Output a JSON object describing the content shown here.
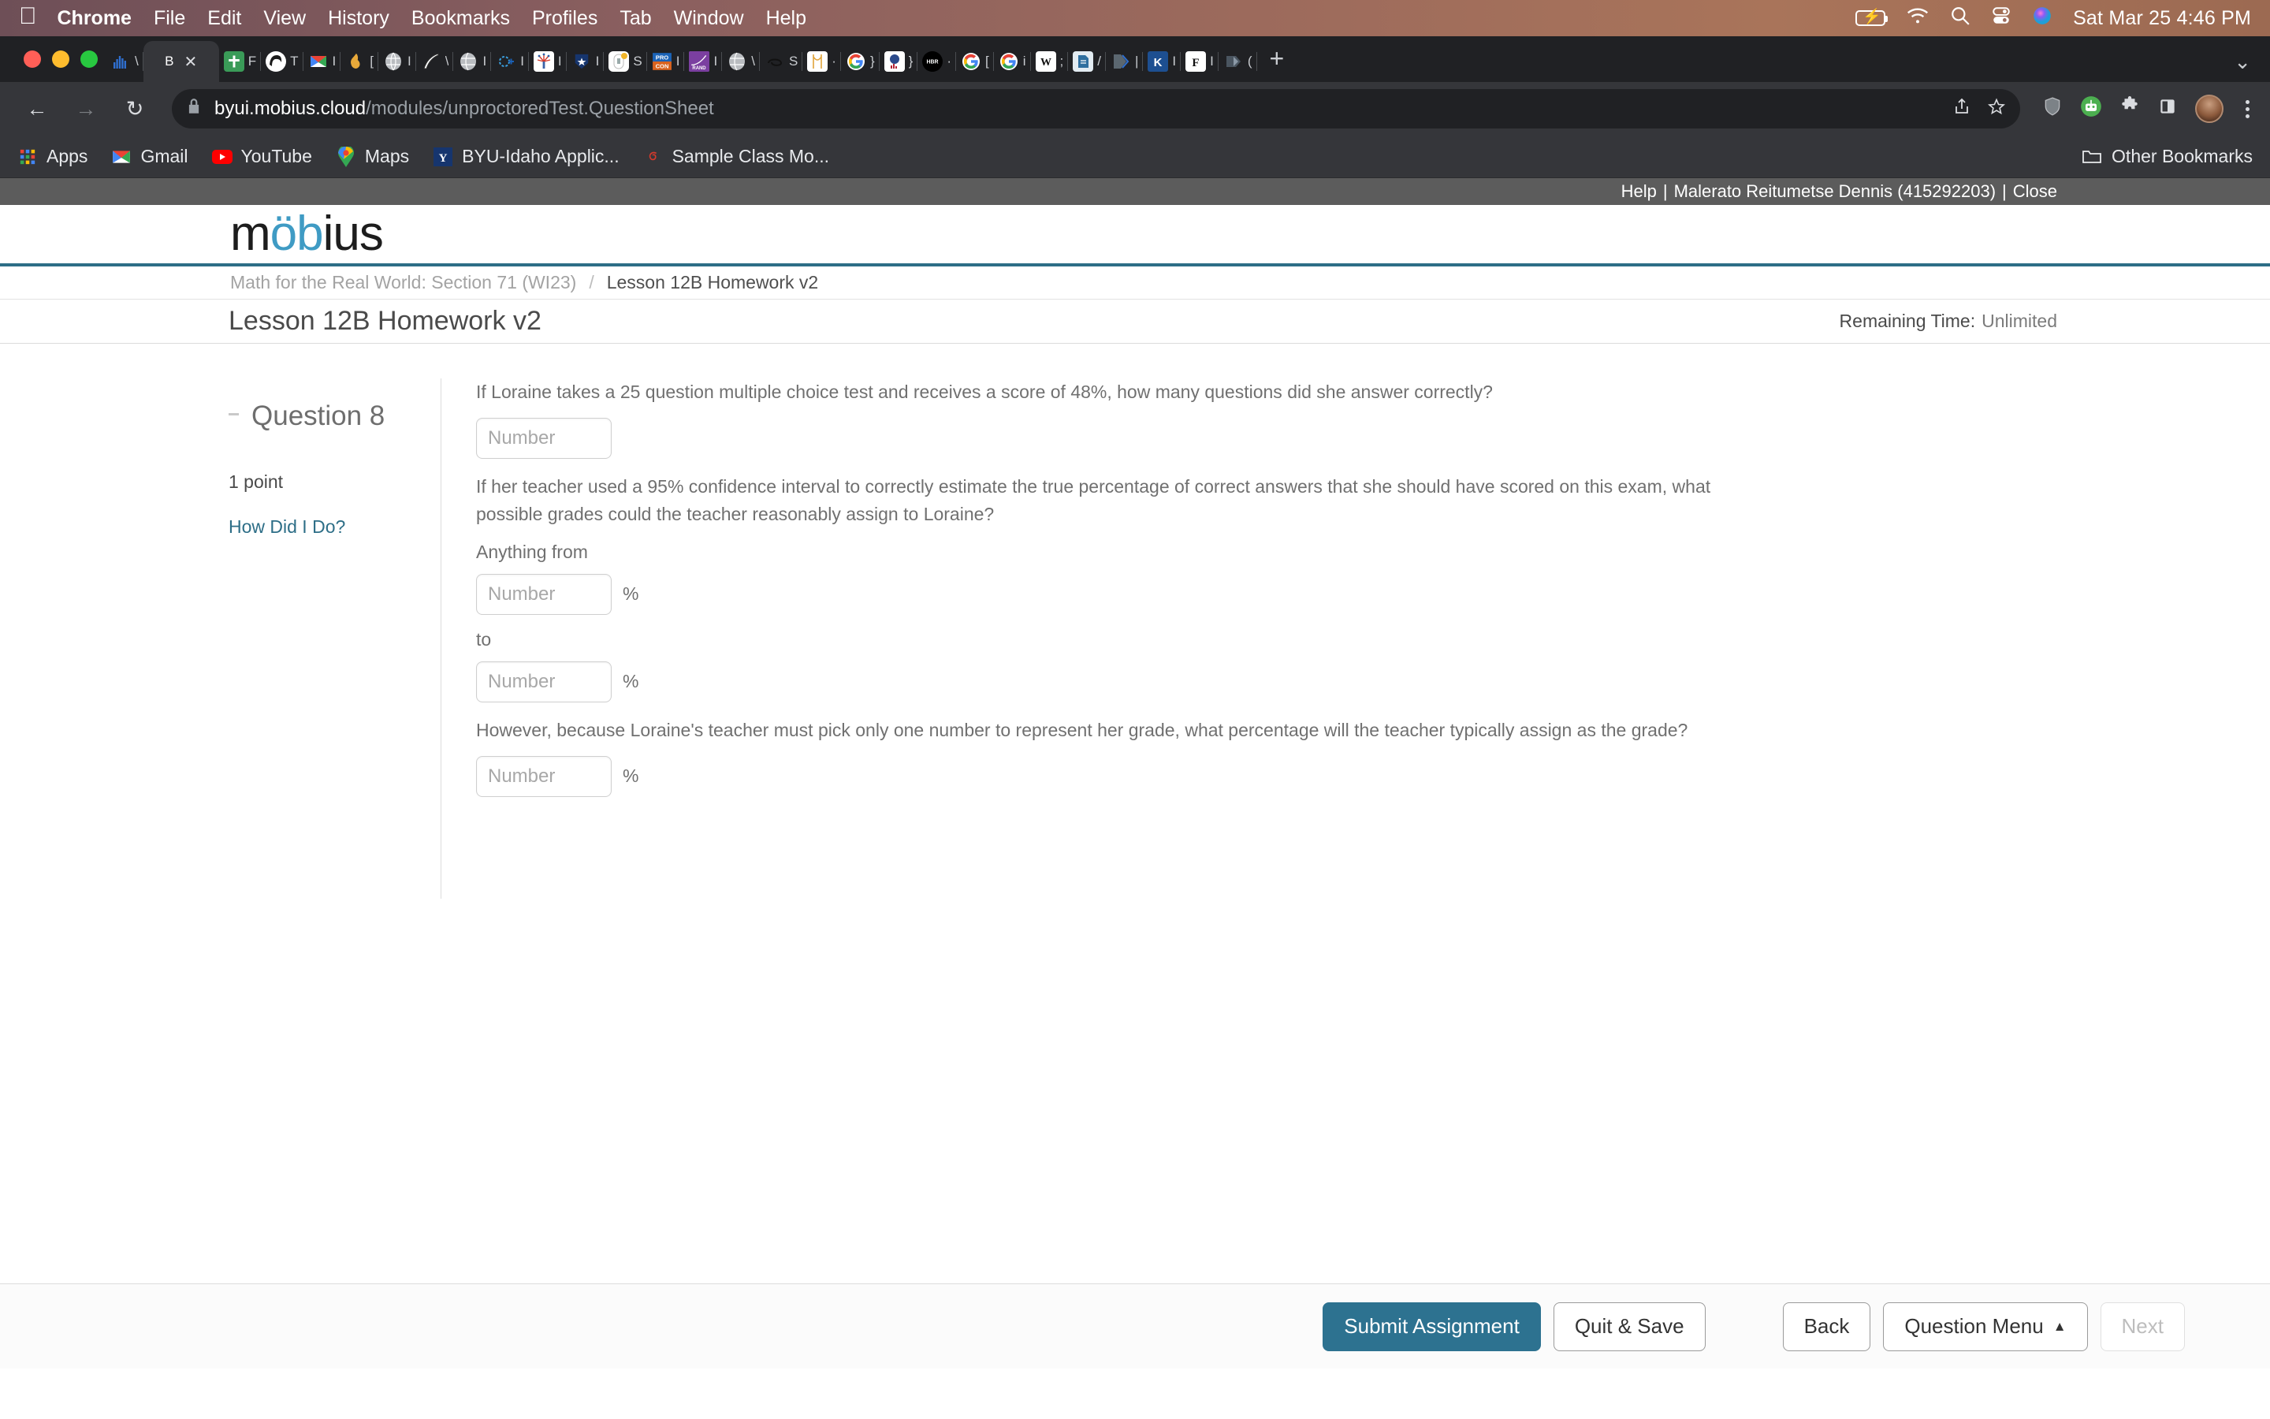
{
  "os_menubar": {
    "apple_glyph": "",
    "items": [
      "Chrome",
      "File",
      "Edit",
      "View",
      "History",
      "Bookmarks",
      "Profiles",
      "Tab",
      "Window",
      "Help"
    ],
    "status_icons": [
      "battery-charging-icon",
      "wifi-icon",
      "spotlight-search-icon",
      "control-center-icon",
      "siri-icon"
    ],
    "clock": "Sat Mar 25  4:46 PM"
  },
  "browser": {
    "window_controls": [
      "close",
      "minimize",
      "zoom"
    ],
    "tabs": [
      {
        "favicon": "chart-bars",
        "title": "\\"
      },
      {
        "favicon": "bxs-letter",
        "title": "B",
        "active": true,
        "close": "✕"
      },
      {
        "favicon": "green-cross",
        "title": "F"
      },
      {
        "favicon": "portrait",
        "title": "T"
      },
      {
        "favicon": "gmail",
        "title": "I"
      },
      {
        "favicon": "flame",
        "title": "["
      },
      {
        "favicon": "globe-gray",
        "title": "I"
      },
      {
        "favicon": "quill",
        "title": "\\"
      },
      {
        "favicon": "globe-gray",
        "title": "I"
      },
      {
        "favicon": "blue-burst",
        "title": "I"
      },
      {
        "favicon": "fireworks",
        "title": "I"
      },
      {
        "favicon": "star-shield",
        "title": "I"
      },
      {
        "favicon": "mouse-badge",
        "title": "S"
      },
      {
        "favicon": "procon",
        "title": "I"
      },
      {
        "favicon": "rand",
        "title": "I"
      },
      {
        "favicon": "globe-gray",
        "title": "\\"
      },
      {
        "favicon": "swirl",
        "title": "S"
      },
      {
        "favicon": "bridge",
        "title": "·"
      },
      {
        "favicon": "google",
        "title": "}"
      },
      {
        "favicon": "globe-chart",
        "title": "}"
      },
      {
        "favicon": "hbr",
        "title": "·"
      },
      {
        "favicon": "google",
        "title": "["
      },
      {
        "favicon": "google",
        "title": "i"
      },
      {
        "favicon": "wikipedia",
        "title": ";"
      },
      {
        "favicon": "doc-blue",
        "title": "/"
      },
      {
        "favicon": "chevron-gray",
        "title": "|"
      },
      {
        "favicon": "k-blue",
        "title": "I"
      },
      {
        "favicon": "f-white",
        "title": "I"
      },
      {
        "favicon": "shape-dark",
        "title": "("
      }
    ],
    "new_tab_glyph": "+",
    "tabstrip_menu_glyph": "⌄",
    "nav": {
      "back": "←",
      "forward": "→",
      "reload": "↻"
    },
    "omnibox": {
      "lock_icon": "🔒",
      "host": "byui.mobius.cloud",
      "path": "/modules/unproctoredTest.QuestionSheet",
      "share_icon": "↑",
      "bookmark_icon": "☆"
    },
    "toolbar_icons": [
      "shield-icon",
      "robot-extension-icon",
      "puzzle-extensions-icon",
      "side-panel-icon",
      "profile-avatar",
      "three-dot-menu"
    ],
    "bookmarks": [
      {
        "label": "Apps",
        "icon": "apps-grid-icon"
      },
      {
        "label": "Gmail",
        "icon": "gmail-icon"
      },
      {
        "label": "YouTube",
        "icon": "youtube-icon"
      },
      {
        "label": "Maps",
        "icon": "maps-pin-icon"
      },
      {
        "label": "BYU-Idaho Applic...",
        "icon": "byui-icon"
      },
      {
        "label": "Sample Class Mo...",
        "icon": "mobius-swirl-icon"
      }
    ],
    "other_bookmarks": {
      "label": "Other Bookmarks",
      "icon": "folder-icon"
    }
  },
  "mobius": {
    "util_bar": {
      "help": "Help",
      "separator": "|",
      "user": "Malerato Reitumetse Dennis (415292203)",
      "close": "Close"
    },
    "logo": {
      "pre": "m",
      "mid": "öb",
      "post": "ius"
    },
    "breadcrumb": {
      "course": "Math for the Real World: Section 71 (WI23)",
      "separator": "/",
      "current": "Lesson 12B Homework v2"
    },
    "page_title": "Lesson 12B Homework v2",
    "remaining_time": {
      "label": "Remaining Time:",
      "value": "Unlimited"
    },
    "question_panel": {
      "collapse_icon": "minus-icon",
      "title": "Question 8",
      "points": "1 point",
      "how_did_i_do": "How Did I Do?"
    },
    "question": {
      "part1_text": "If Loraine takes a 25 question multiple choice test and receives a score of 48%, how many questions did she answer correctly?",
      "part1_placeholder": "Number",
      "part2_text": "If her teacher used a 95% confidence interval to correctly estimate the true percentage of correct answers that she should have scored on this exam, what possible grades could the teacher reasonably assign to Loraine?",
      "from_label": "Anything from",
      "from_placeholder": "Number",
      "from_unit": "%",
      "to_label": "to",
      "to_placeholder": "Number",
      "to_unit": "%",
      "part3_text": "However, because Loraine's teacher must pick only one number to represent her grade, what percentage will the teacher typically assign as the grade?",
      "part3_placeholder": "Number",
      "part3_unit": "%"
    },
    "footer": {
      "submit": "Submit Assignment",
      "quit_save": "Quit & Save",
      "back": "Back",
      "question_menu": "Question Menu",
      "question_menu_caret": "▲",
      "next": "Next"
    },
    "colors": {
      "accent": "#2d7290",
      "rule": "#2d6e87",
      "link": "#2d6e87",
      "logo_blue": "#3f9bc4",
      "util_bar_bg": "#5c5c5c"
    }
  }
}
